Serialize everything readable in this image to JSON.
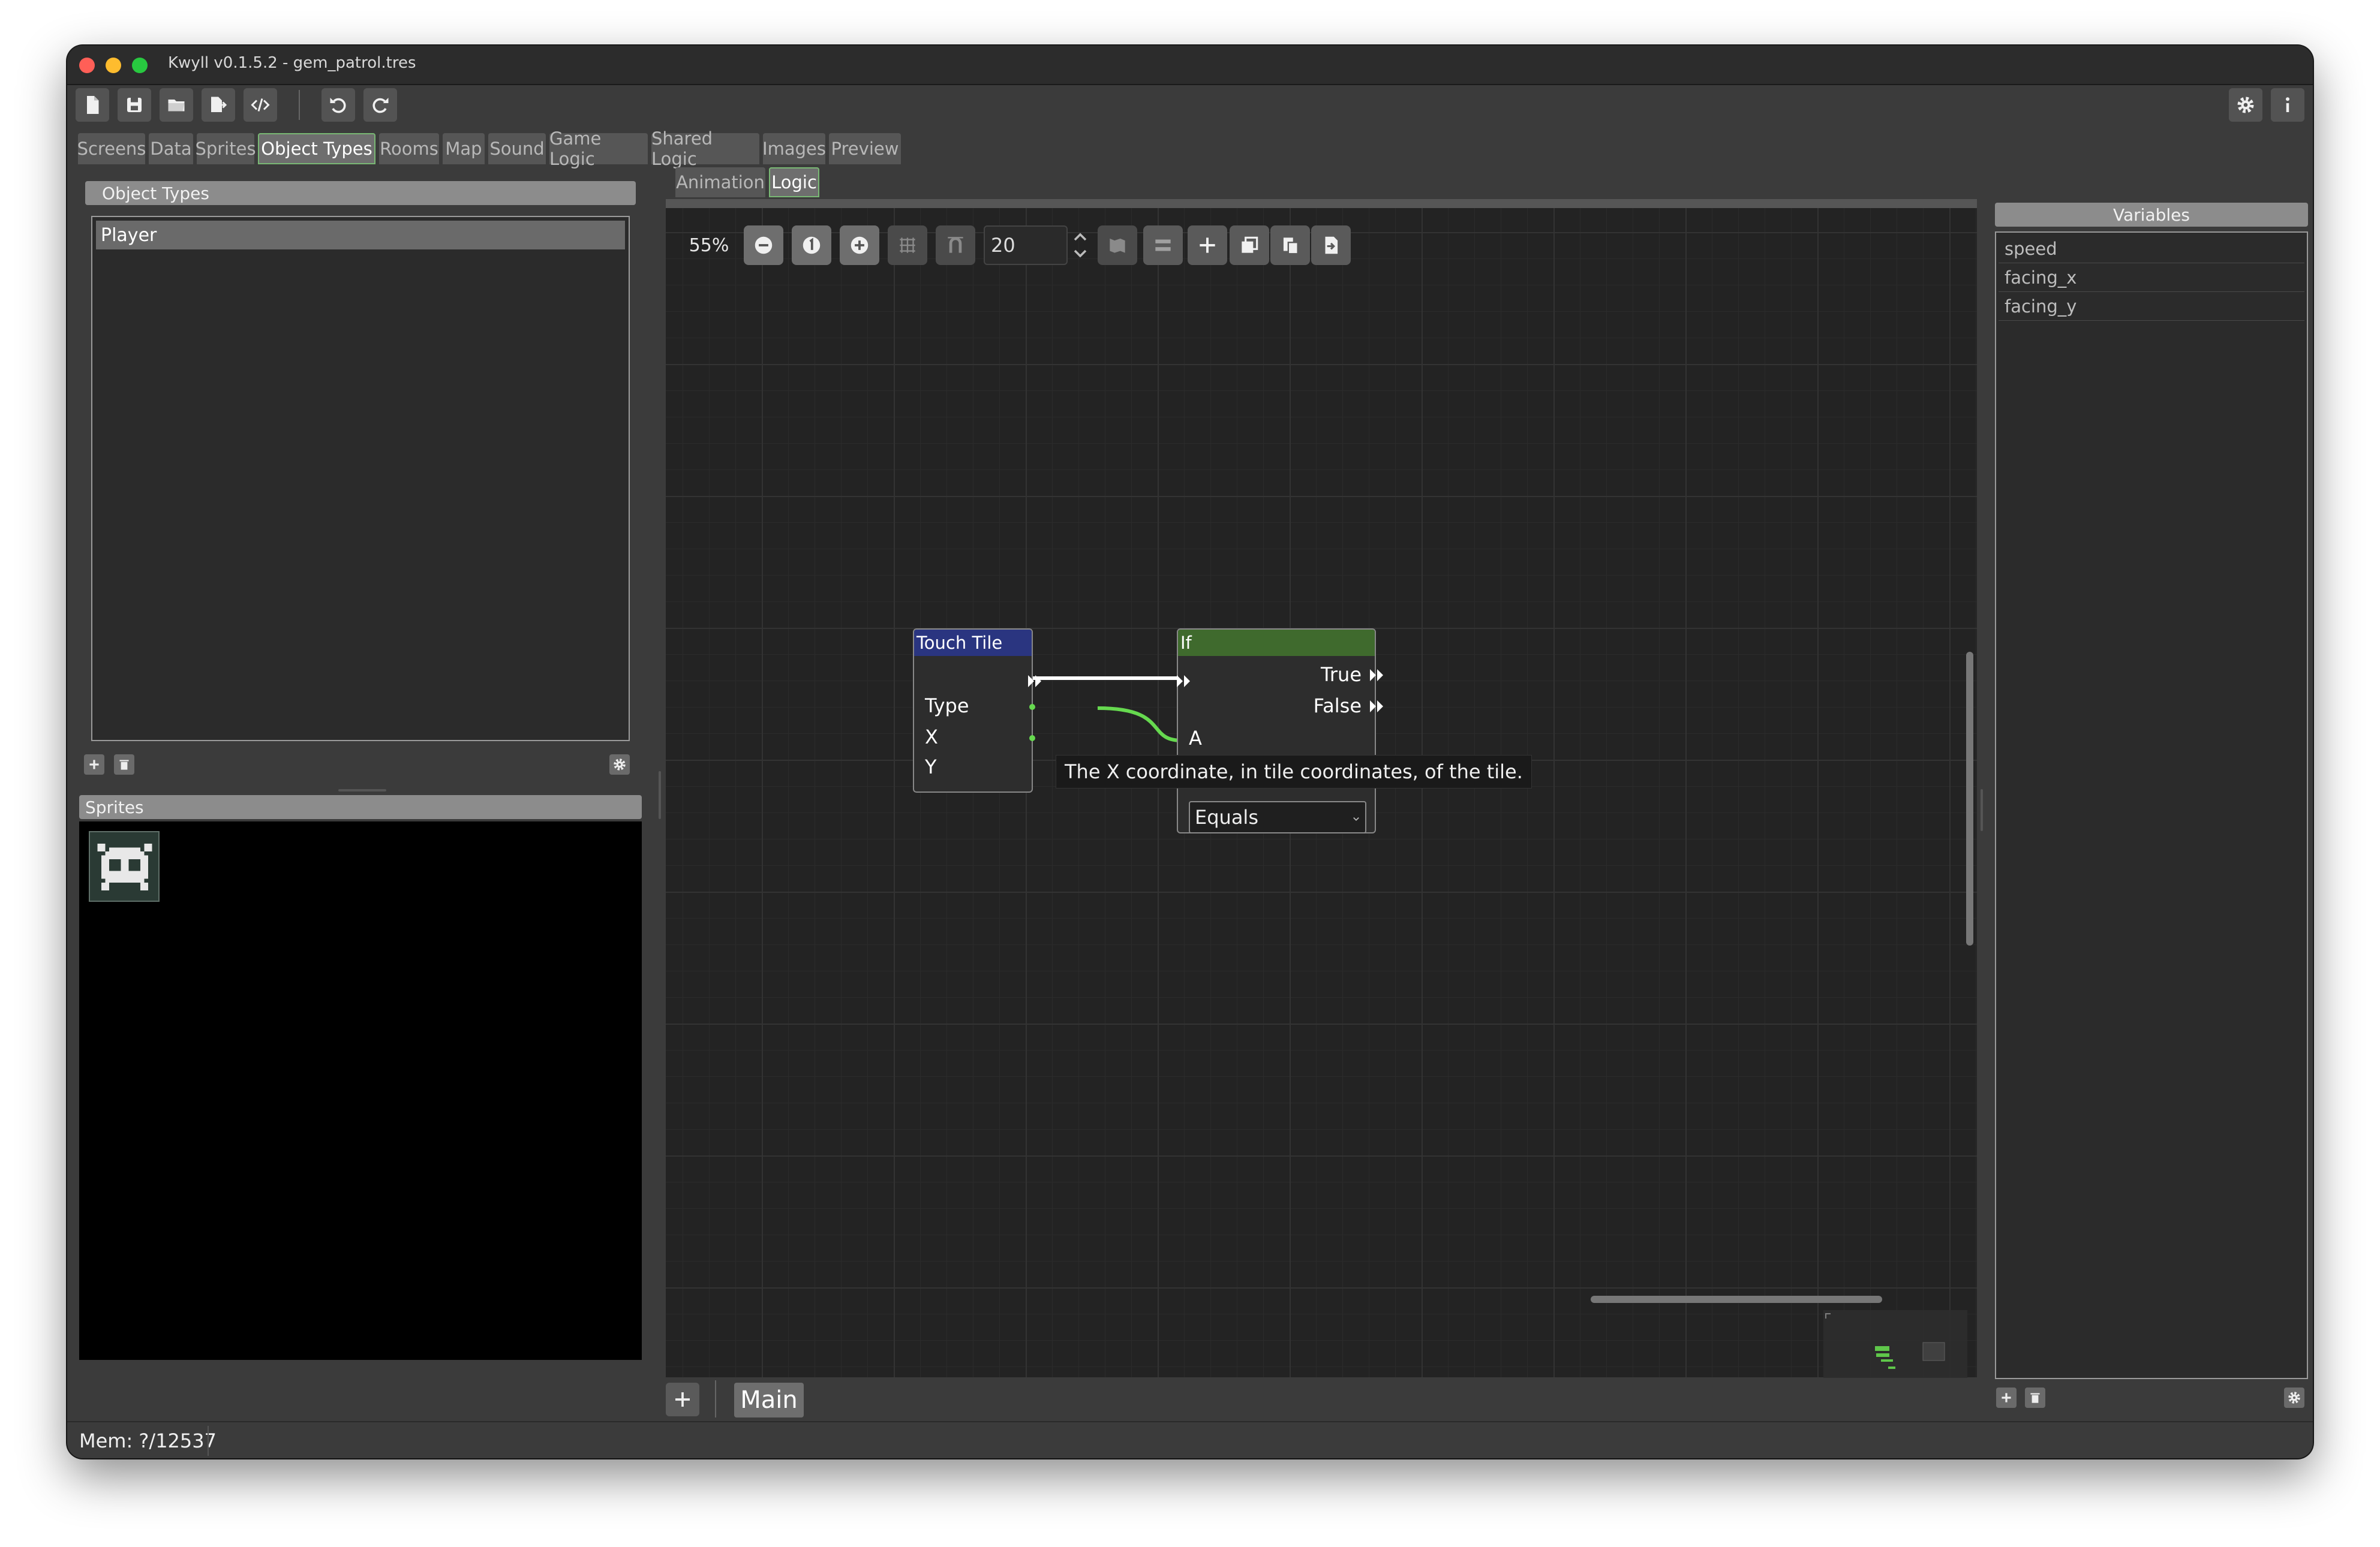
{
  "window": {
    "title": "Kwyll v0.1.5.2 - gem_patrol.tres",
    "traffic_colors": [
      "#ff5f57",
      "#febc2e",
      "#28c840"
    ]
  },
  "toolbar": {
    "icons": [
      "new-file-icon",
      "save-icon",
      "open-folder-icon",
      "export-icon",
      "code-icon",
      "undo-icon",
      "redo-icon",
      "gear-icon",
      "info-icon"
    ]
  },
  "main_tabs": [
    {
      "label": "Screens"
    },
    {
      "label": "Data"
    },
    {
      "label": "Sprites"
    },
    {
      "label": "Object Types",
      "active": true
    },
    {
      "label": "Rooms"
    },
    {
      "label": "Map"
    },
    {
      "label": "Sound"
    },
    {
      "label": "Game Logic"
    },
    {
      "label": "Shared Logic"
    },
    {
      "label": "Images"
    },
    {
      "label": "Preview"
    }
  ],
  "sub_tabs": [
    {
      "label": "Animation"
    },
    {
      "label": "Logic",
      "active": true
    }
  ],
  "object_types": {
    "header": "Object Types",
    "items": [
      "Player"
    ],
    "selected": "Player"
  },
  "sprites": {
    "header": "Sprites"
  },
  "graph_toolbar": {
    "zoom": "55%",
    "snap_value": "20"
  },
  "nodes": {
    "touch_tile": {
      "title": "Touch Tile",
      "color": "#2a3580",
      "outputs": [
        "Type",
        "X",
        "Y"
      ]
    },
    "if_node": {
      "title": "If",
      "color": "#3f6a2d",
      "outputs": [
        "True",
        "False"
      ],
      "input_a": "A",
      "operator": "Equals"
    }
  },
  "tooltip": "The X coordinate, in tile coordinates, of the tile.",
  "graph_tabs": {
    "main_label": "Main"
  },
  "variables": {
    "header": "Variables",
    "items": [
      "speed",
      "facing_x",
      "facing_y"
    ]
  },
  "status": {
    "memory": "Mem: ?/12537"
  },
  "colors": {
    "accent": "#79b874",
    "connection": "#66d94f"
  }
}
